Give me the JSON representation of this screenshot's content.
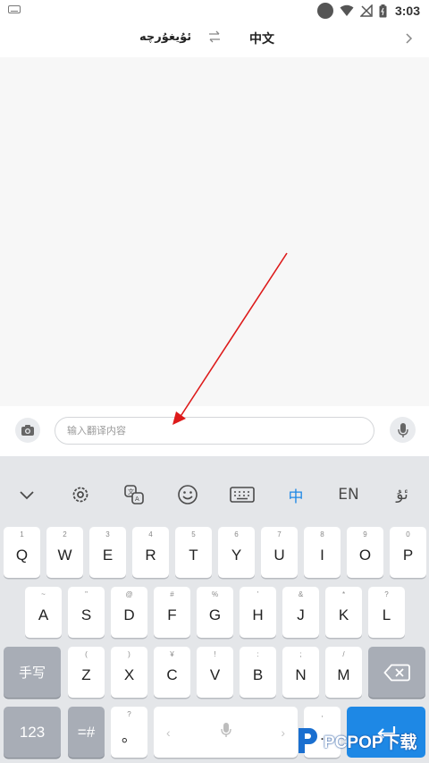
{
  "status_bar": {
    "time": "3:03"
  },
  "lang_bar": {
    "source": "ئۇيغۇرچە",
    "swap_icon": "swap-arrows-icon",
    "target": "中文",
    "next_icon": "chevron-right-icon"
  },
  "input": {
    "placeholder": "输入翻译内容",
    "camera_icon": "camera-icon",
    "mic_icon": "microphone-icon"
  },
  "annotation": {
    "color": "#dd1a1a"
  },
  "keyboard": {
    "toolbar": [
      {
        "name": "collapse",
        "icon": "chevron-down-icon"
      },
      {
        "name": "settings",
        "icon": "gear-icon"
      },
      {
        "name": "translate",
        "icon": "translate-icon"
      },
      {
        "name": "emoji",
        "icon": "emoji-icon"
      },
      {
        "name": "keyboard-layout",
        "icon": "keyboard-icon"
      },
      {
        "name": "chinese",
        "label": "中"
      },
      {
        "name": "english",
        "label": "EN"
      },
      {
        "name": "uyghur",
        "label": "ئۇ"
      }
    ],
    "row1": [
      {
        "key": "Q",
        "sub": "1"
      },
      {
        "key": "W",
        "sub": "2"
      },
      {
        "key": "E",
        "sub": "3"
      },
      {
        "key": "R",
        "sub": "4"
      },
      {
        "key": "T",
        "sub": "5"
      },
      {
        "key": "Y",
        "sub": "6"
      },
      {
        "key": "U",
        "sub": "7"
      },
      {
        "key": "I",
        "sub": "8"
      },
      {
        "key": "O",
        "sub": "9"
      },
      {
        "key": "P",
        "sub": "0"
      }
    ],
    "row2": [
      {
        "key": "A",
        "sub": "~"
      },
      {
        "key": "S",
        "sub": "\""
      },
      {
        "key": "D",
        "sub": "@"
      },
      {
        "key": "F",
        "sub": "#"
      },
      {
        "key": "G",
        "sub": "%"
      },
      {
        "key": "H",
        "sub": "'"
      },
      {
        "key": "J",
        "sub": "&"
      },
      {
        "key": "K",
        "sub": "*"
      },
      {
        "key": "L",
        "sub": "?"
      }
    ],
    "row3_left": "手写",
    "row3": [
      {
        "key": "Z",
        "sub": "("
      },
      {
        "key": "X",
        "sub": ")"
      },
      {
        "key": "C",
        "sub": "¥"
      },
      {
        "key": "V",
        "sub": "!"
      },
      {
        "key": "B",
        "sub": ":"
      },
      {
        "key": "N",
        "sub": ";"
      },
      {
        "key": "M",
        "sub": "/"
      }
    ],
    "backspace_icon": "backspace-icon",
    "row4": {
      "numbers": "123",
      "symbols": "=#",
      "comma": {
        "key": "。",
        "sub": "?"
      },
      "space_icon": "microphone-icon",
      "space_left": "‹",
      "space_right": "›",
      "period": {
        "key": ".",
        "sub": ","
      },
      "enter_icon": "enter-icon"
    }
  },
  "watermark": {
    "text": "PCPOP下载"
  }
}
